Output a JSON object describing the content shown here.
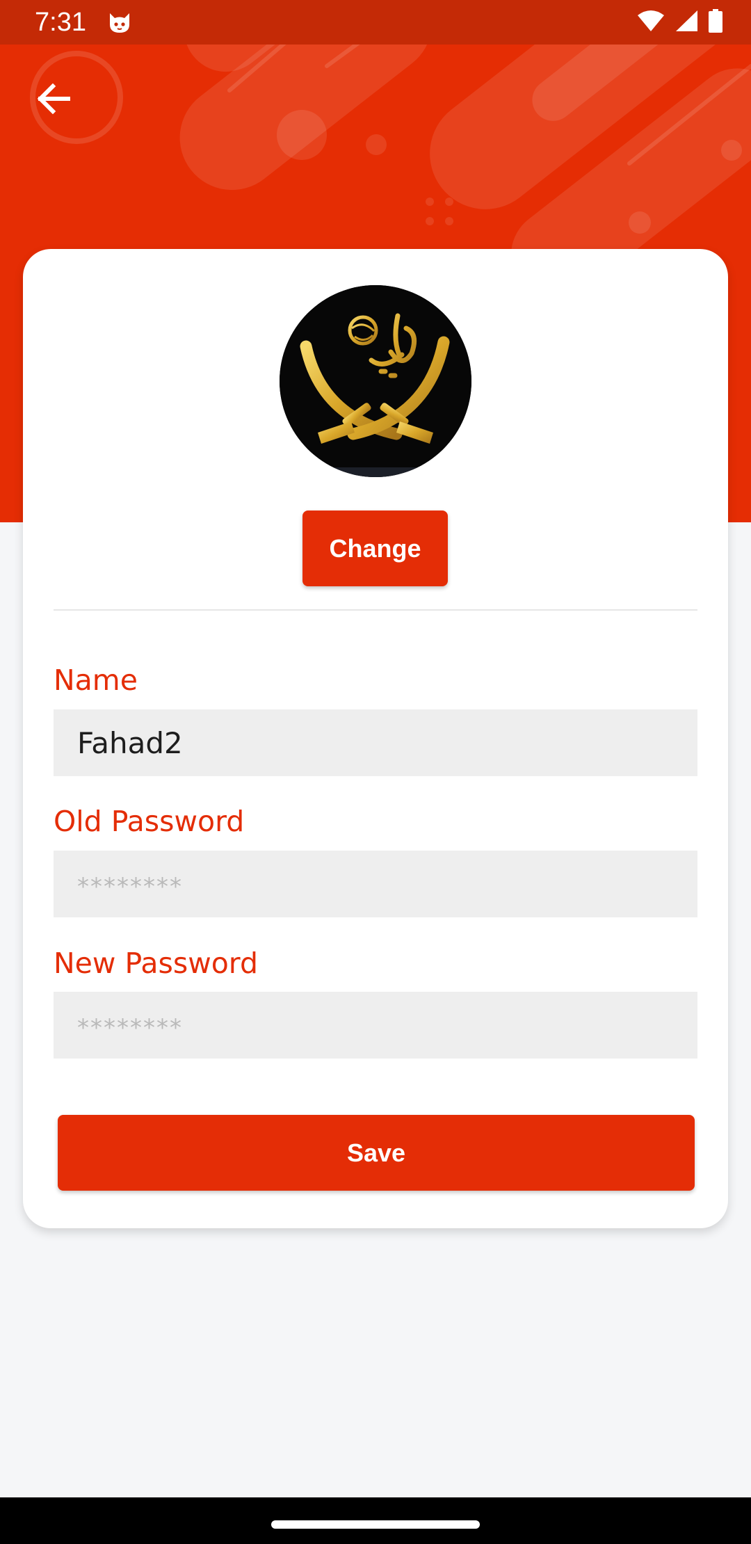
{
  "status_bar": {
    "time": "7:31",
    "icons": [
      "cat-notification-icon",
      "wifi-icon",
      "signal-icon",
      "battery-icon"
    ]
  },
  "header": {
    "back_icon": "arrow-left-icon"
  },
  "profile": {
    "avatar": "profile-image",
    "change_label": "Change"
  },
  "form": {
    "name_label": "Name",
    "name_value": "Fahad2",
    "old_password_label": "Old Password",
    "old_password_placeholder": "********",
    "new_password_label": "New Password",
    "new_password_placeholder": "********",
    "save_label": "Save"
  },
  "colors": {
    "accent": "#e42d06",
    "header_bg": "#e52d04",
    "status_bar_bg": "#c42a06",
    "page_bg": "#f5f6f8",
    "input_bg": "#eeeeee"
  }
}
